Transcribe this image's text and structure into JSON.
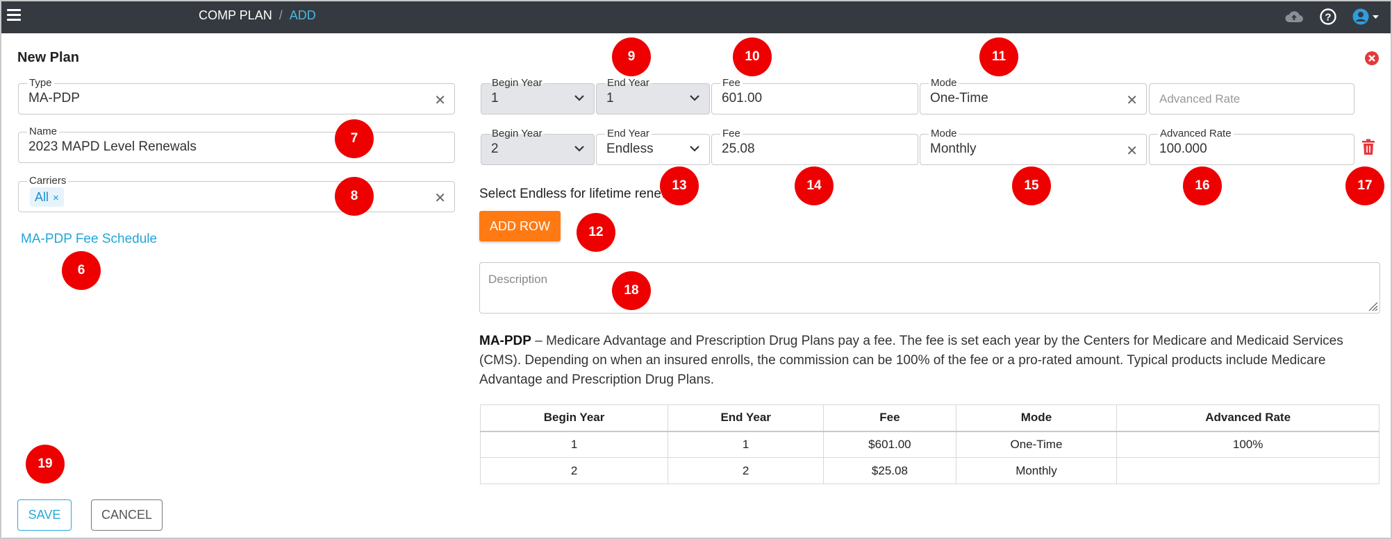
{
  "header": {
    "breadcrumb_root": "COMP PLAN",
    "breadcrumb_sep": "/",
    "breadcrumb_current": "ADD",
    "icons": [
      "menu-icon",
      "cloud-upload-icon",
      "help-icon",
      "user-account-icon"
    ]
  },
  "form": {
    "title": "New Plan",
    "type_label": "Type",
    "type_value": "MA-PDP",
    "name_label": "Name",
    "name_value": "2023 MAPD Level Renewals",
    "carriers_label": "Carriers",
    "carriers_chip": "All",
    "carriers_chip_remove": "×",
    "fee_schedule_link": "MA-PDP Fee Schedule"
  },
  "rows": [
    {
      "begin_label": "Begin Year",
      "begin_value": "1",
      "end_label": "End Year",
      "end_value": "1",
      "fee_label": "Fee",
      "fee_value": "601.00",
      "mode_label": "Mode",
      "mode_value": "One-Time",
      "rate_placeholder": "Advanced Rate"
    },
    {
      "begin_label": "Begin Year",
      "begin_value": "2",
      "end_label": "End Year",
      "end_value": "Endless",
      "fee_label": "Fee",
      "fee_value": "25.08",
      "mode_label": "Mode",
      "mode_value": "Monthly",
      "rate_label": "Advanced Rate",
      "rate_value": "100.000"
    }
  ],
  "helper_text": "Select Endless for lifetime renewals.",
  "add_row_label": "ADD ROW",
  "description_placeholder": "Description",
  "info": {
    "term": "MA-PDP",
    "text": " – Medicare Advantage and Prescription Drug Plans pay a fee. The fee is set each year by the Centers for Medicare and Medicaid Services (CMS). Depending on when an insured enrolls, the commission can be 100% of the fee or a pro-rated amount. Typical products include Medicare Advantage and Prescription Drug Plans."
  },
  "table": {
    "headers": [
      "Begin Year",
      "End Year",
      "Fee",
      "Mode",
      "Advanced Rate"
    ],
    "rows": [
      [
        "1",
        "1",
        "$601.00",
        "One-Time",
        "100%"
      ],
      [
        "2",
        "2",
        "$25.08",
        "Monthly",
        ""
      ]
    ]
  },
  "buttons": {
    "save": "SAVE",
    "cancel": "CANCEL"
  },
  "badges": [
    "6",
    "7",
    "8",
    "9",
    "10",
    "11",
    "12",
    "13",
    "14",
    "15",
    "16",
    "17",
    "18",
    "19"
  ],
  "colors": {
    "topbar": "#353a40",
    "accent": "#22a6d8",
    "add_row": "#ff7a12",
    "badge": "#ee0000",
    "danger": "#e5383b"
  }
}
